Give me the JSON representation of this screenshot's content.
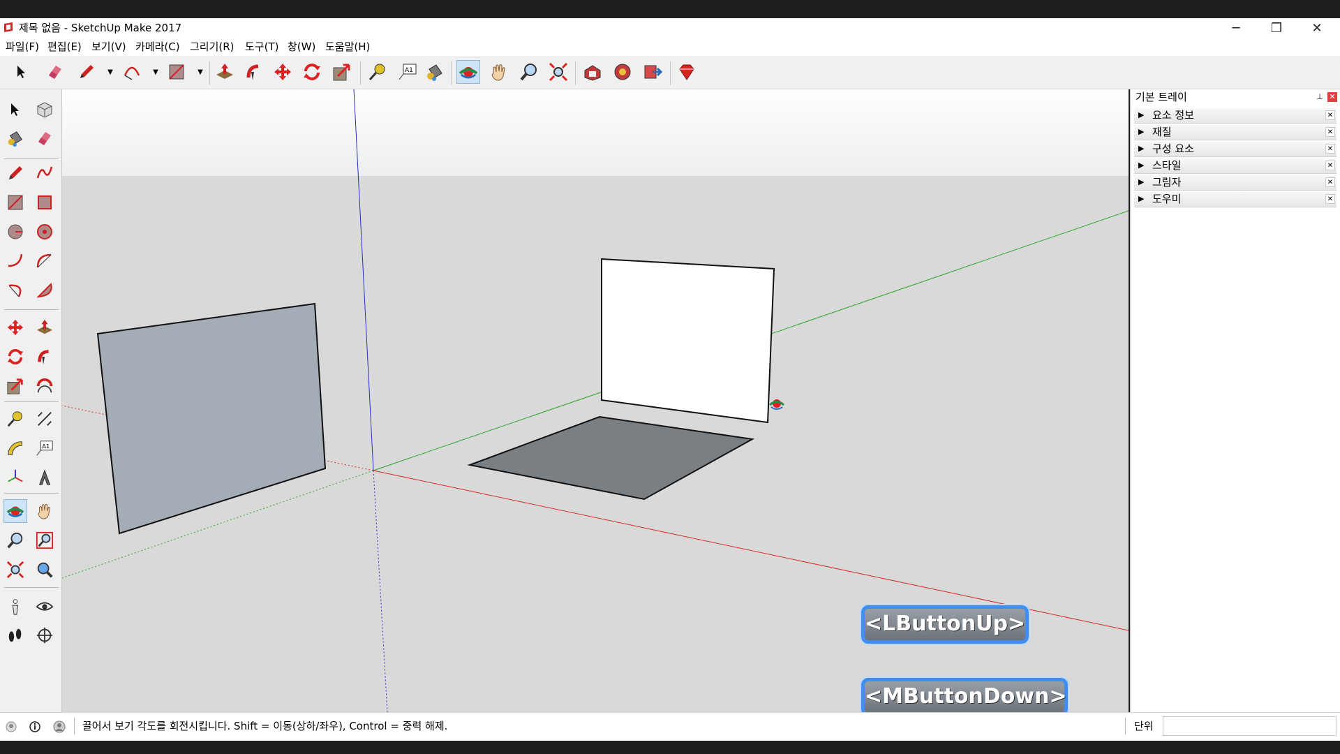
{
  "window": {
    "title": "제목 없음 - SketchUp Make 2017",
    "controls": {
      "minimize": "─",
      "restore": "❐",
      "close": "✕"
    }
  },
  "menu": [
    "파일(F)",
    "편집(E)",
    "보기(V)",
    "카메라(C)",
    "그리기(R)",
    "도구(T)",
    "창(W)",
    "도움말(H)"
  ],
  "toolbar": {
    "icons": [
      "select-tool",
      "eraser-tool",
      "line-tool",
      "arc-tool",
      "rectangle-tool",
      "push-pull-tool",
      "follow-me-tool",
      "move-tool",
      "rotate-tool",
      "scale-tool",
      "tape-measure-tool",
      "text-tool",
      "paint-bucket-tool",
      "orbit-tool",
      "pan-tool",
      "zoom-tool",
      "zoom-extents-tool",
      "warehouse-tool",
      "extension-warehouse-tool",
      "send-to-layout-tool",
      "extension-manager-tool"
    ],
    "active": "orbit-tool"
  },
  "tray": {
    "title": "기본 트레이",
    "panels": [
      "요소 정보",
      "재질",
      "구성 요소",
      "스타일",
      "그림자",
      "도우미"
    ]
  },
  "status": {
    "text": "끌어서 보기 각도를 회전시킵니다. Shift = 이동(상하/좌우), Control = 중력 해제.",
    "units_label": "단위",
    "units_value": ""
  },
  "overlays": {
    "lbutton": "<LButtonUp>",
    "mbutton": "<MButtonDown>"
  },
  "colors": {
    "sky": "#f3f4f5",
    "ground": "#d9d9d9",
    "face_front": "#ffffff",
    "face_back": "#a4adb6",
    "face_floor": "#7a7f84",
    "axis_red": "#d42a2a",
    "axis_green": "#2aa52a",
    "axis_blue": "#2a2ac8"
  }
}
